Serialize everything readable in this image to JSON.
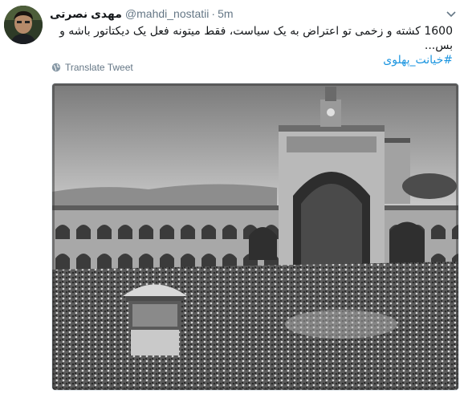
{
  "tweet": {
    "display_name": "مهدی نصرتی",
    "handle": "@mahdi_nostatii",
    "separator": "·",
    "time": "5m",
    "text": "1600 کشته و زخمی تو اعتراض به یک سیاست، فقط میتونه فعل یک دیکتاتور باشه و بس...",
    "hashtag": "#خیانت_پهلوی",
    "translate_label": "Translate Tweet",
    "icons": {
      "avatar": "user-avatar-photo",
      "menu": "chevron-down-icon",
      "translate": "globe-icon"
    },
    "colors": {
      "hashtag": "#1b95e0",
      "muted": "#657786"
    }
  }
}
